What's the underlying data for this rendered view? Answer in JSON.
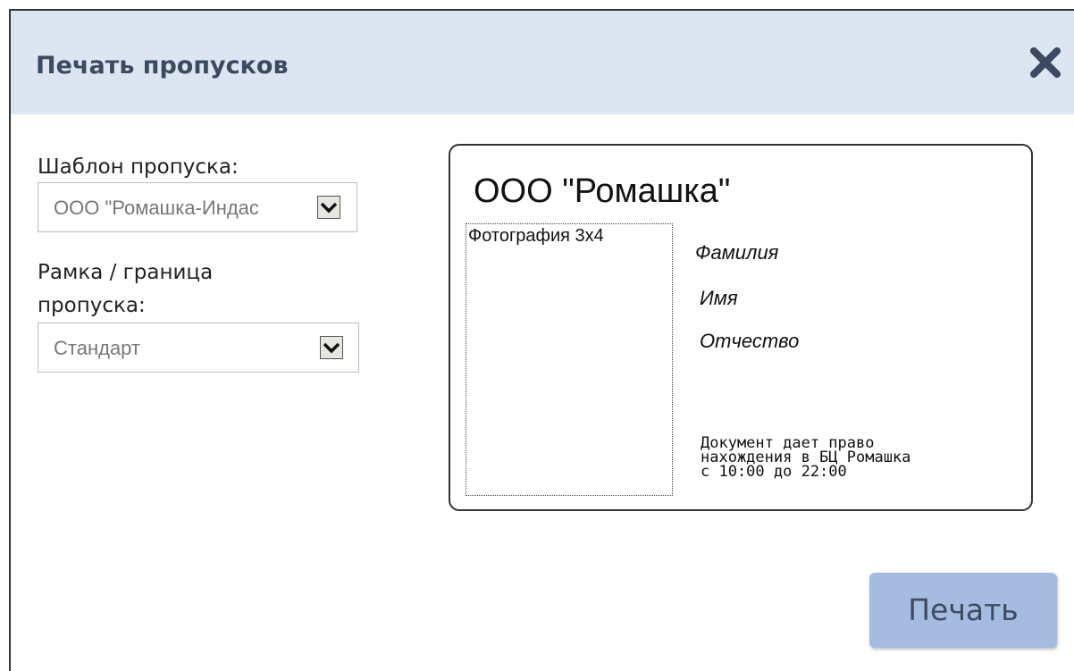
{
  "dialog": {
    "title": "Печать пропусков",
    "close_icon": "close-x-icon",
    "accent_color": "#dce6f2"
  },
  "form": {
    "template_label": "Шаблон пропуска:",
    "template_value": "ООО \"Ромашка-Индас",
    "frame_label_line1": "Рамка / граница",
    "frame_label_line2": "пропуска:",
    "frame_value": "Стандарт"
  },
  "preview": {
    "company": "ООО \"Ромашка\"",
    "photo_label": "Фотография 3x4",
    "surname": "Фамилия",
    "name": "Имя",
    "patronymic": "Отчество",
    "note_line1": "Документ дает право",
    "note_line2": "нахождения в БЦ Ромашка",
    "note_line3": "с 10:00 до 22:00"
  },
  "actions": {
    "print_label": "Печать",
    "print_color": "#a5bce0"
  }
}
